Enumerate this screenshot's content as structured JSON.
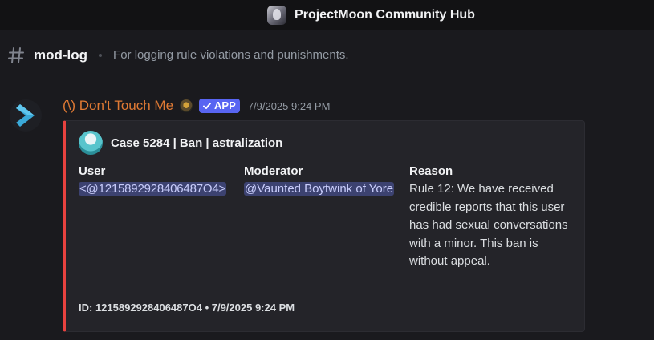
{
  "server": {
    "name": "ProjectMoon Community Hub"
  },
  "channel": {
    "name": "mod-log",
    "topic": "For logging rule violations and punishments."
  },
  "message": {
    "author": "(\\) Don't Touch Me",
    "badge": "APP",
    "timestamp": "7/9/2025 9:24 PM",
    "embed": {
      "accent_color": "#e8423f",
      "author_name": "Case 5284 | Ban | astralization",
      "fields": {
        "user": {
          "name": "User",
          "value": "<@1215892928406487O4>"
        },
        "moderator": {
          "name": "Moderator",
          "value": "@Vaunted Boytwink of Yore"
        },
        "reason": {
          "name": "Reason",
          "value": "Rule 12: We have received credible reports that this user has had sexual conversations with a minor. This ban is without appeal."
        }
      },
      "footer": "ID: 1215892928406487O4 • 7/9/2025 9:24 PM"
    }
  },
  "icons": {
    "server": "server-icon",
    "channel": "hash-icon",
    "bot_avatar": "chevron-bot-icon",
    "badge": "checkmark-icon"
  },
  "colors": {
    "username": "#e07a34",
    "app_badge": "#5865f2",
    "mention_bg": "#3c4270"
  }
}
